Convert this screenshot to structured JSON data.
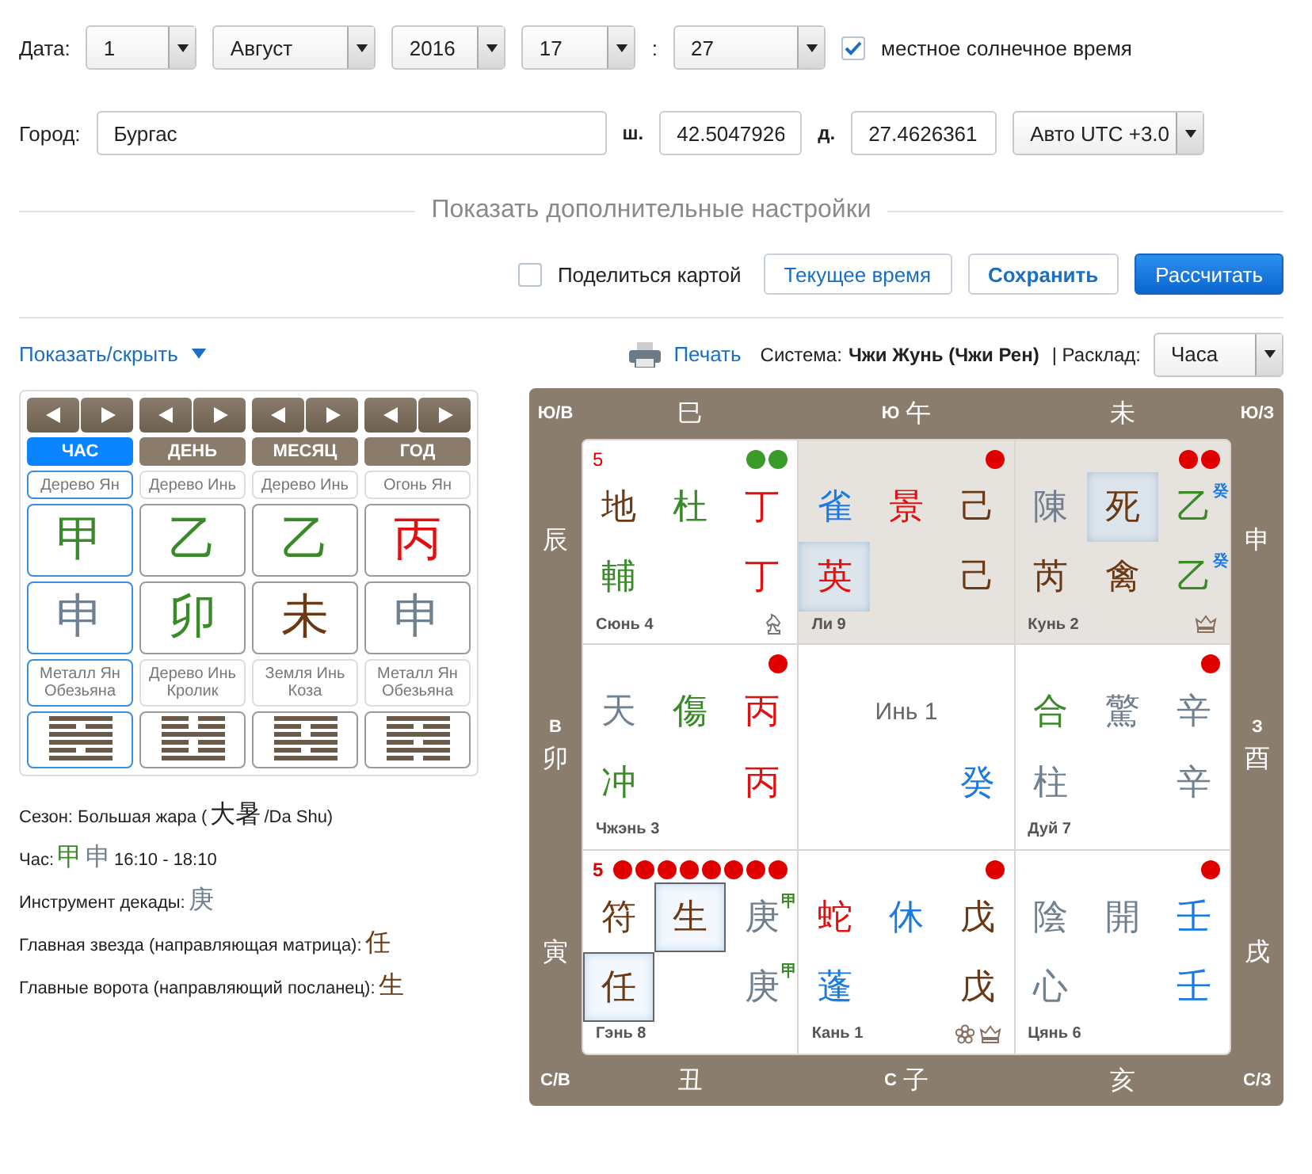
{
  "date_row": {
    "label": "Дата:",
    "day": "1",
    "month": "Август",
    "year": "2016",
    "hour": "17",
    "separator": ":",
    "minute": "27",
    "solar_time": {
      "label": "местное солнечное время",
      "checked": true
    }
  },
  "city_row": {
    "label": "Город:",
    "city": "Бургас",
    "lat_label": "ш.",
    "lat": "42.5047926",
    "lon_label": "д.",
    "lon": "27.4626361",
    "timezone": "Авто UTC +3.0"
  },
  "more_settings": "Показать дополнительные настройки",
  "actions": {
    "share": {
      "label": "Поделиться картой",
      "checked": false
    },
    "buttons": [
      {
        "label": "Текущее время",
        "kind": "outline"
      },
      {
        "label": "Сохранить",
        "kind": "strong"
      },
      {
        "label": "Рассчитать",
        "kind": "primary"
      }
    ]
  },
  "toolbar": {
    "toggle": "Показать/скрыть",
    "print": "Печать",
    "system_label": "Система:",
    "system": "Чжи Жунь (Чжи Рен)",
    "layout_label": "| Расклад:",
    "layout": "Часа"
  },
  "pillars": [
    {
      "tab": {
        "label": "ЧАС",
        "selected": true
      },
      "element": "Дерево Ян",
      "stem": {
        "char": "甲",
        "color": "#3a8a2a"
      },
      "branch": {
        "char": "申",
        "color": "#6f8090"
      },
      "branch_element": "Металл Ян",
      "animal": "Обезьяна",
      "hexagram": [
        true,
        false,
        true,
        true,
        false,
        true
      ]
    },
    {
      "tab": {
        "label": "ДЕНЬ",
        "selected": false
      },
      "element": "Дерево Инь",
      "stem": {
        "char": "乙",
        "color": "#3a8a2a"
      },
      "branch": {
        "char": "卯",
        "color": "#3a8a2a"
      },
      "branch_element": "Дерево Инь",
      "animal": "Кролик",
      "hexagram": [
        false,
        false,
        true,
        false,
        false,
        true
      ]
    },
    {
      "tab": {
        "label": "МЕСЯЦ",
        "selected": false
      },
      "element": "Дерево Инь",
      "stem": {
        "char": "乙",
        "color": "#3a8a2a"
      },
      "branch": {
        "char": "未",
        "color": "#6b3a14"
      },
      "branch_element": "Земля Инь",
      "animal": "Коза",
      "hexagram": [
        true,
        false,
        false,
        true,
        false,
        true
      ]
    },
    {
      "tab": {
        "label": "ГОД",
        "selected": false
      },
      "element": "Огонь Ян",
      "stem": {
        "char": "丙",
        "color": "#e01010"
      },
      "branch": {
        "char": "申",
        "color": "#6f8090"
      },
      "branch_element": "Металл Ян",
      "animal": "Обезьяна",
      "hexagram": [
        true,
        false,
        true,
        false,
        true,
        false
      ]
    }
  ],
  "info": [
    {
      "parts": [
        {
          "kind": "text",
          "text": "Сезон: Большая жара ("
        },
        {
          "kind": "glyph",
          "text": "大暑",
          "color": "#222222"
        },
        {
          "kind": "text",
          "text": "/Da Shu)"
        }
      ]
    },
    {
      "parts": [
        {
          "kind": "text",
          "text": "Час:"
        },
        {
          "kind": "glyph",
          "text": "甲",
          "color": "#3a8a2a"
        },
        {
          "kind": "glyph",
          "text": "申",
          "color": "#6f8090"
        },
        {
          "kind": "text",
          "text": "16:10 - 18:10"
        }
      ]
    },
    {
      "parts": [
        {
          "kind": "text",
          "text": "Инструмент декады:"
        },
        {
          "kind": "glyph",
          "text": "庚",
          "color": "#6f8090"
        }
      ]
    },
    {
      "parts": [
        {
          "kind": "text",
          "text": "Главная звезда (направляющая матрица):"
        },
        {
          "kind": "glyph",
          "text": "任",
          "color": "#6b3a14"
        }
      ]
    },
    {
      "parts": [
        {
          "kind": "text",
          "text": "Главные ворота (направляющий посланец):"
        },
        {
          "kind": "glyph",
          "text": "生",
          "color": "#6b3a14"
        }
      ]
    }
  ],
  "board": {
    "corners": [
      "Ю/В",
      "Ю/З",
      "С/В",
      "С/З"
    ],
    "top": [
      {
        "branch": "巳"
      },
      {
        "dir": "Ю",
        "branch": "午"
      },
      {
        "branch": "未"
      }
    ],
    "left": [
      {
        "branch": "辰"
      },
      {
        "dir": "В",
        "branch": "卯"
      },
      {
        "branch": "寅"
      }
    ],
    "right": [
      {
        "branch": "申"
      },
      {
        "dir": "З",
        "branch": "酉"
      },
      {
        "branch": "戌"
      }
    ],
    "bottom": [
      {
        "branch": "丑"
      },
      {
        "dir": "С",
        "branch": "子"
      },
      {
        "branch": "亥"
      }
    ],
    "palaces": [
      {
        "shaded": false,
        "number": {
          "text": "5",
          "bold": false
        },
        "dots": [
          {
            "color": "#3a9a2a"
          },
          {
            "color": "#3a9a2a"
          }
        ],
        "cells": [
          {
            "kind": "glyph",
            "char": "地",
            "color": "#6b3a14",
            "highlighted": false
          },
          {
            "kind": "glyph",
            "char": "杜",
            "color": "#3a8a2a",
            "highlighted": false
          },
          {
            "kind": "glyph",
            "char": "丁",
            "color": "#e01010",
            "highlighted": false
          },
          {
            "kind": "glyph",
            "char": "輔",
            "color": "#3a8a2a",
            "highlighted": false
          },
          {
            "kind": "empty"
          },
          {
            "kind": "glyph",
            "char": "丁",
            "color": "#e01010",
            "highlighted": false
          }
        ],
        "name": "Сюнь 4",
        "marks": [
          {
            "kind": "knight"
          }
        ]
      },
      {
        "shaded": true,
        "dots": [
          {
            "color": "#e00000"
          }
        ],
        "cells": [
          {
            "kind": "glyph",
            "char": "雀",
            "color": "#1a7ae0",
            "highlighted": false
          },
          {
            "kind": "glyph",
            "char": "景",
            "color": "#e01010",
            "highlighted": false
          },
          {
            "kind": "glyph",
            "char": "己",
            "color": "#6b3a14",
            "highlighted": false
          },
          {
            "kind": "glyph",
            "char": "英",
            "color": "#e01010",
            "highlighted": true
          },
          {
            "kind": "empty"
          },
          {
            "kind": "glyph",
            "char": "己",
            "color": "#6b3a14",
            "highlighted": false
          }
        ],
        "name": "Ли 9"
      },
      {
        "shaded": true,
        "dots": [
          {
            "color": "#e00000"
          },
          {
            "color": "#e00000"
          }
        ],
        "cells": [
          {
            "kind": "glyph",
            "char": "陳",
            "color": "#6f8090",
            "highlighted": false
          },
          {
            "kind": "glyph",
            "char": "死",
            "color": "#6b3a14",
            "highlighted": true
          },
          {
            "kind": "glyph",
            "char": "乙",
            "color": "#3a8a2a",
            "highlighted": false,
            "sup": {
              "char": "癸",
              "color": "#1a7ae0"
            }
          },
          {
            "kind": "glyph",
            "char": "芮",
            "color": "#6b3a14",
            "highlighted": false
          },
          {
            "kind": "glyph",
            "char": "禽",
            "color": "#6b3a14",
            "highlighted": false
          },
          {
            "kind": "glyph",
            "char": "乙",
            "color": "#3a8a2a",
            "highlighted": false,
            "sup": {
              "char": "癸",
              "color": "#1a7ae0"
            }
          }
        ],
        "name": "Кунь 2",
        "marks": [
          {
            "kind": "crown"
          }
        ]
      },
      {
        "shaded": false,
        "dots": [
          {
            "color": "#e00000"
          }
        ],
        "cells": [
          {
            "kind": "glyph",
            "char": "天",
            "color": "#6f8090",
            "highlighted": false
          },
          {
            "kind": "glyph",
            "char": "傷",
            "color": "#3a8a2a",
            "highlighted": false
          },
          {
            "kind": "glyph",
            "char": "丙",
            "color": "#e01010",
            "highlighted": false
          },
          {
            "kind": "glyph",
            "char": "冲",
            "color": "#3a8a2a",
            "highlighted": false
          },
          {
            "kind": "empty"
          },
          {
            "kind": "glyph",
            "char": "丙",
            "color": "#e01010",
            "highlighted": false
          }
        ],
        "name": "Чжэнь 3"
      },
      {
        "shaded": false,
        "title": "Инь 1",
        "cells": [
          {
            "kind": "empty"
          },
          {
            "kind": "empty"
          },
          {
            "kind": "glyph",
            "char": "癸",
            "color": "#1a7ae0",
            "highlighted": false
          }
        ]
      },
      {
        "shaded": false,
        "dots": [
          {
            "color": "#e00000"
          }
        ],
        "cells": [
          {
            "kind": "glyph",
            "char": "合",
            "color": "#3a8a2a",
            "highlighted": false
          },
          {
            "kind": "glyph",
            "char": "驚",
            "color": "#6f8090",
            "highlighted": false
          },
          {
            "kind": "glyph",
            "char": "辛",
            "color": "#6f8090",
            "highlighted": false
          },
          {
            "kind": "glyph",
            "char": "柱",
            "color": "#6f8090",
            "highlighted": false
          },
          {
            "kind": "empty"
          },
          {
            "kind": "glyph",
            "char": "辛",
            "color": "#6f8090",
            "highlighted": false
          }
        ],
        "name": "Дуй 7"
      },
      {
        "shaded": false,
        "number": {
          "text": "5",
          "bold": true
        },
        "dots": [
          {
            "color": "#e00000"
          },
          {
            "color": "#e00000"
          },
          {
            "color": "#e00000"
          },
          {
            "color": "#e00000"
          },
          {
            "color": "#e00000"
          },
          {
            "color": "#e00000"
          },
          {
            "color": "#e00000"
          },
          {
            "color": "#e00000"
          }
        ],
        "cells": [
          {
            "kind": "glyph",
            "char": "符",
            "color": "#6b3a14",
            "highlighted": false,
            "boxed": false
          },
          {
            "kind": "glyph",
            "char": "生",
            "color": "#6b3a14",
            "highlighted": true,
            "boxed": true
          },
          {
            "kind": "glyph",
            "char": "庚",
            "color": "#6f8090",
            "highlighted": false,
            "boxed": false,
            "sup": {
              "char": "甲",
              "color": "#3a8a2a"
            }
          },
          {
            "kind": "glyph",
            "char": "任",
            "color": "#6b3a14",
            "highlighted": true,
            "boxed": true
          },
          {
            "kind": "empty"
          },
          {
            "kind": "glyph",
            "char": "庚",
            "color": "#6f8090",
            "highlighted": false,
            "boxed": false,
            "sup": {
              "char": "甲",
              "color": "#3a8a2a"
            }
          }
        ],
        "name": "Гэнь 8"
      },
      {
        "shaded": false,
        "dots": [
          {
            "color": "#e00000"
          }
        ],
        "cells": [
          {
            "kind": "glyph",
            "char": "蛇",
            "color": "#e01010",
            "highlighted": false
          },
          {
            "kind": "glyph",
            "char": "休",
            "color": "#1a7ae0",
            "highlighted": false
          },
          {
            "kind": "glyph",
            "char": "戊",
            "color": "#6b3a14",
            "highlighted": false
          },
          {
            "kind": "glyph",
            "char": "蓬",
            "color": "#1a7ae0",
            "highlighted": false
          },
          {
            "kind": "empty"
          },
          {
            "kind": "glyph",
            "char": "戊",
            "color": "#6b3a14",
            "highlighted": false
          }
        ],
        "name": "Кань 1",
        "marks": [
          {
            "kind": "flower"
          },
          {
            "kind": "crown"
          }
        ]
      },
      {
        "shaded": false,
        "dots": [
          {
            "color": "#e00000"
          }
        ],
        "cells": [
          {
            "kind": "glyph",
            "char": "陰",
            "color": "#6f8090",
            "highlighted": false
          },
          {
            "kind": "glyph",
            "char": "開",
            "color": "#6f8090",
            "highlighted": false
          },
          {
            "kind": "glyph",
            "char": "壬",
            "color": "#1a7ae0",
            "highlighted": false
          },
          {
            "kind": "glyph",
            "char": "心",
            "color": "#6f8090",
            "highlighted": false
          },
          {
            "kind": "empty"
          },
          {
            "kind": "glyph",
            "char": "壬",
            "color": "#1a7ae0",
            "highlighted": false
          }
        ],
        "name": "Цянь 6"
      }
    ]
  }
}
